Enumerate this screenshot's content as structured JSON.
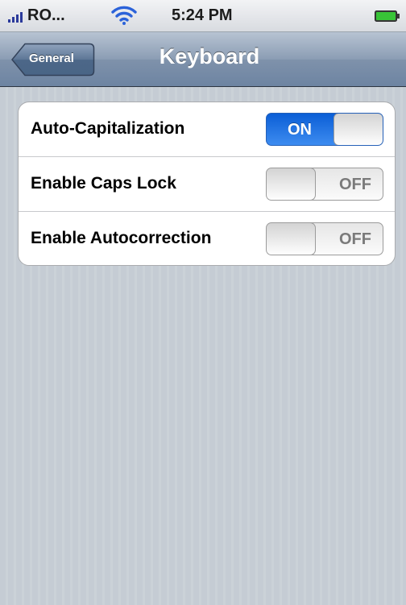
{
  "status_bar": {
    "carrier": "RO...",
    "time": "5:24 PM",
    "signal_icon": "signal-bars-icon",
    "wifi_icon": "wifi-icon",
    "battery_icon": "battery-icon"
  },
  "nav": {
    "back_label": "General",
    "title": "Keyboard"
  },
  "settings": [
    {
      "label": "Auto-Capitalization",
      "state": "ON",
      "on": true
    },
    {
      "label": "Enable Caps Lock",
      "state": "OFF",
      "on": false
    },
    {
      "label": "Enable Autocorrection",
      "state": "OFF",
      "on": false
    }
  ],
  "colors": {
    "nav_tint": "#6d84a2",
    "switch_on": "#1f6fe3",
    "background": "#c5ccd4"
  }
}
